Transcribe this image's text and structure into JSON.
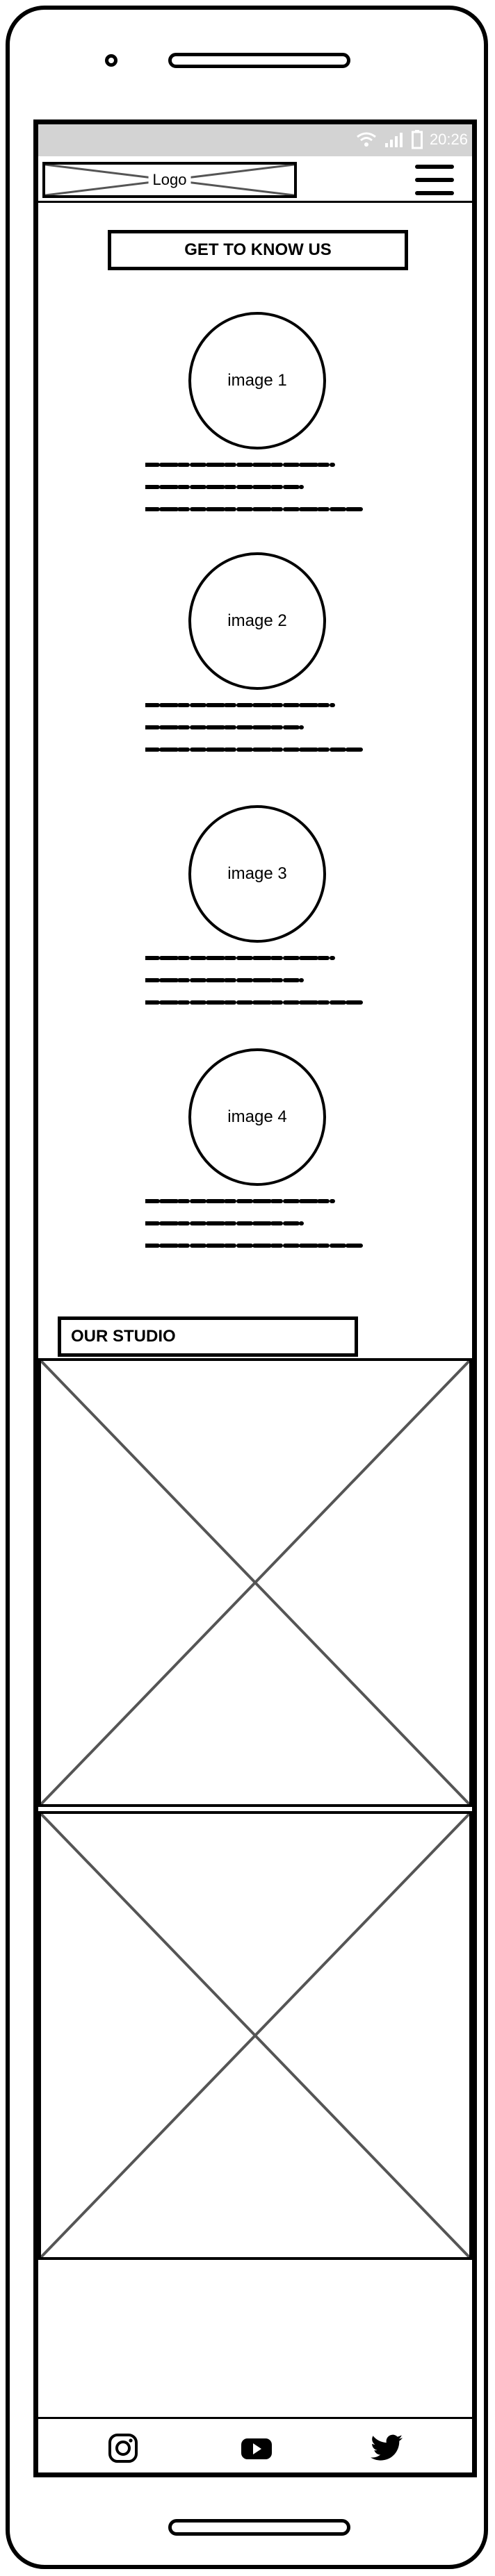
{
  "status_bar": {
    "time": "20:26",
    "icons": [
      "wifi-icon",
      "signal-icon",
      "battery-icon"
    ]
  },
  "header": {
    "logo_label": "Logo",
    "menu_icon": "hamburger-menu-icon"
  },
  "get_to_know_us": {
    "heading": "GET TO KNOW US",
    "members": [
      {
        "image_label": "image 1"
      },
      {
        "image_label": "image 2"
      },
      {
        "image_label": "image 3"
      },
      {
        "image_label": "image 4"
      }
    ]
  },
  "our_studio": {
    "heading": "OUR STUDIO",
    "images": [
      "image-placeholder",
      "image-placeholder"
    ]
  },
  "footer": {
    "social_icons": [
      "instagram-icon",
      "youtube-icon",
      "twitter-icon"
    ]
  },
  "colors": {
    "status_bar_bg": "#d3d3d3",
    "outline": "#000000",
    "placeholder_cross": "#555555"
  }
}
